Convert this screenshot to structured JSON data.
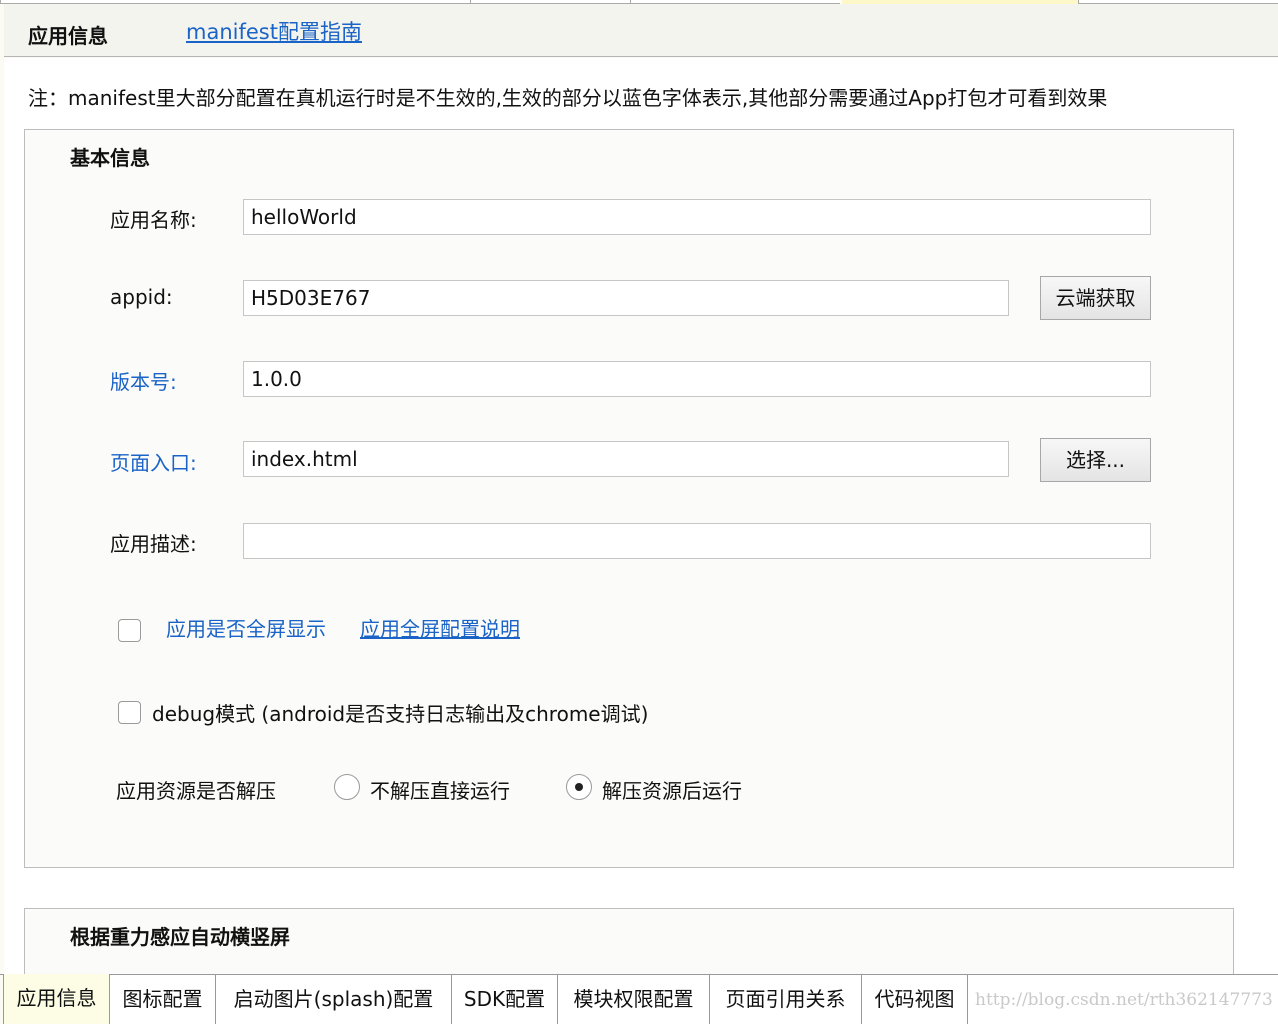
{
  "header": {
    "title": "应用信息",
    "guide_link": "manifest配置指南"
  },
  "note": "注：manifest里大部分配置在真机运行时是不生效的,生效的部分以蓝色字体表示,其他部分需要通过App打包才可看到效果",
  "basic": {
    "title": "基本信息",
    "app_name": {
      "label": "应用名称:",
      "value": "helloWorld"
    },
    "appid": {
      "label": "appid:",
      "value": "H5D03E767",
      "button": "云端获取"
    },
    "version": {
      "label": "版本号:",
      "value": "1.0.0"
    },
    "entry": {
      "label": "页面入口:",
      "value": "index.html",
      "button": "选择..."
    },
    "description": {
      "label": "应用描述:",
      "value": ""
    },
    "fullscreen": {
      "label": "应用是否全屏显示",
      "link": "应用全屏配置说明",
      "checked": false
    },
    "debug": {
      "label": "debug模式 (android是否支持日志输出及chrome调试)",
      "checked": false
    },
    "decompress": {
      "label": "应用资源是否解压",
      "options": [
        "不解压直接运行",
        "解压资源后运行"
      ],
      "selected": "解压资源后运行"
    }
  },
  "gravity": {
    "title": "根据重力感应自动横竖屏"
  },
  "tabs": [
    "应用信息",
    "图标配置",
    "启动图片(splash)配置",
    "SDK配置",
    "模块权限配置",
    "页面引用关系",
    "代码视图"
  ],
  "active_tab": "应用信息",
  "watermark": "http://blog.csdn.net/rth362147773",
  "colors": {
    "link_blue": "#1a63c7",
    "active_tab_bg": "#fdfde6"
  }
}
